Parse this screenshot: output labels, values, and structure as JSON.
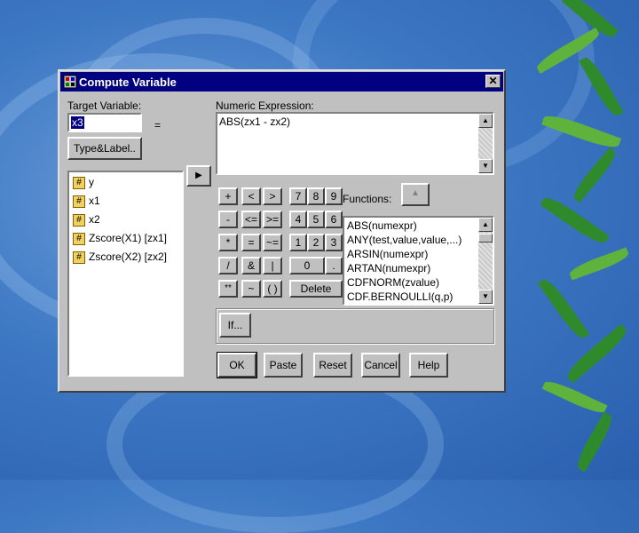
{
  "window": {
    "title": "Compute Variable",
    "close_glyph": "✕"
  },
  "target": {
    "label": "Target Variable:",
    "value": "x3",
    "equals": "="
  },
  "type_label_button": "Type&Label..",
  "expression": {
    "label": "Numeric Expression:",
    "value": "ABS(zx1 - zx2)"
  },
  "variables": [
    {
      "name": "y"
    },
    {
      "name": "x1"
    },
    {
      "name": "x2"
    },
    {
      "name": "Zscore(X1) [zx1]"
    },
    {
      "name": "Zscore(X2) [zx2]"
    }
  ],
  "move_arrow": "▶",
  "keypad": {
    "ops": [
      "+",
      "<",
      ">",
      "-",
      "<=",
      ">=",
      "*",
      "=",
      "~=",
      "/",
      "&",
      "|",
      "**",
      "~",
      "( )"
    ],
    "digits": [
      "7",
      "8",
      "9",
      "4",
      "5",
      "6",
      "1",
      "2",
      "3",
      "0",
      "."
    ],
    "delete": "Delete"
  },
  "functions": {
    "label": "Functions:",
    "up_arrow": "▲",
    "items": [
      "ABS(numexpr)",
      "ANY(test,value,value,...)",
      "ARSIN(numexpr)",
      "ARTAN(numexpr)",
      "CDFNORM(zvalue)",
      "CDF.BERNOULLI(q,p)"
    ]
  },
  "if_button": "If...",
  "buttons": {
    "ok": "OK",
    "paste": "Paste",
    "reset": "Reset",
    "cancel": "Cancel",
    "help": "Help"
  }
}
